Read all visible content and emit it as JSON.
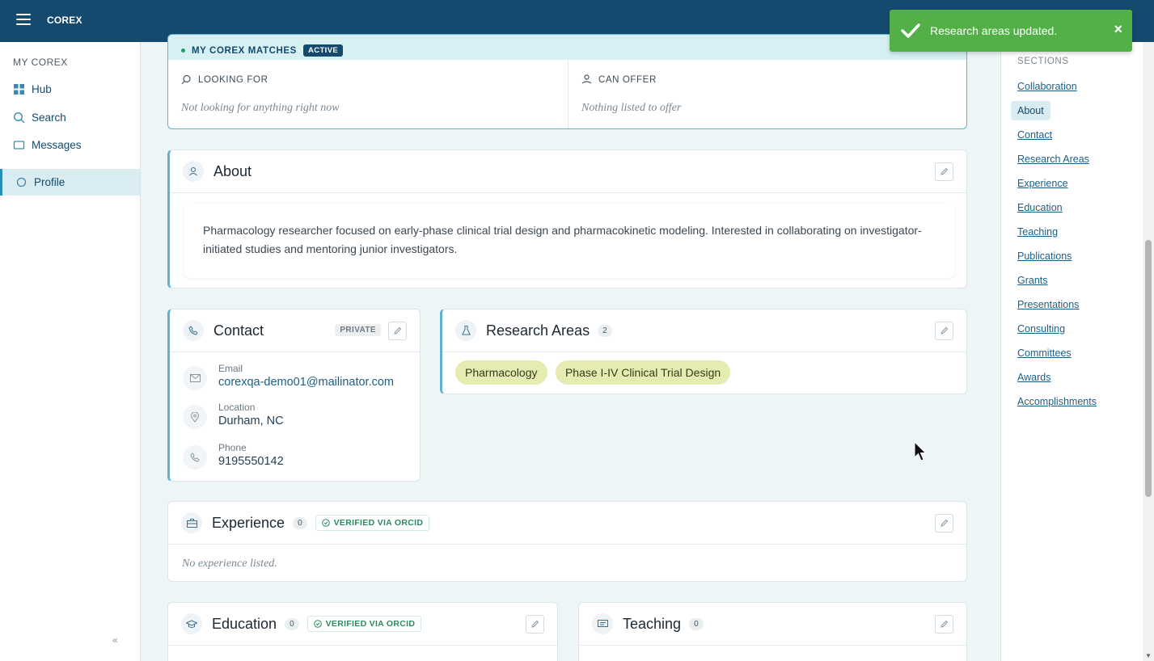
{
  "app": {
    "brand": "COREX"
  },
  "sidebar": {
    "heading": "MY COREX",
    "items": [
      {
        "label": "Hub",
        "icon": "grid-icon"
      },
      {
        "label": "Search",
        "icon": "search-icon"
      },
      {
        "label": "Messages",
        "icon": "message-icon"
      },
      {
        "label": "Profile",
        "icon": "profile-icon",
        "active": true
      }
    ],
    "collapse_label": "«"
  },
  "matches": {
    "title": "MY COREX MATCHES",
    "status": "ACTIVE",
    "looking_for": {
      "label": "LOOKING FOR",
      "value": "Not looking for anything right now"
    },
    "can_offer": {
      "label": "CAN OFFER",
      "value": "Nothing listed to offer"
    }
  },
  "about": {
    "title": "About",
    "text": "Pharmacology researcher focused on early-phase clinical trial design and pharmacokinetic modeling. Interested in collaborating on investigator-initiated studies and mentoring junior investigators."
  },
  "contact": {
    "title": "Contact",
    "privacy": "PRIVATE",
    "email_label": "Email",
    "email": "corexqa-demo01@mailinator.com",
    "location_label": "Location",
    "location": "Durham, NC",
    "phone_label": "Phone",
    "phone": "9195550142"
  },
  "research": {
    "title": "Research Areas",
    "count": "2",
    "areas": [
      "Pharmacology",
      "Phase I-IV Clinical Trial Design"
    ]
  },
  "experience": {
    "title": "Experience",
    "count": "0",
    "verified": "VERIFIED VIA ORCID",
    "empty": "No experience listed."
  },
  "education": {
    "title": "Education",
    "count": "0",
    "verified": "VERIFIED VIA ORCID"
  },
  "teaching": {
    "title": "Teaching",
    "count": "0"
  },
  "sections_nav": {
    "heading": "SECTIONS",
    "items": [
      "Collaboration",
      "About",
      "Contact",
      "Research Areas",
      "Experience",
      "Education",
      "Teaching",
      "Publications",
      "Grants",
      "Presentations",
      "Consulting",
      "Committees",
      "Awards",
      "Accomplishments"
    ],
    "active": "About"
  },
  "toast": {
    "message": "Research areas updated.",
    "close": "×"
  },
  "colors": {
    "topbar": "#134a6e",
    "accent": "#5fb3cd",
    "toast": "#52b047",
    "chip": "#e6ebb1"
  }
}
